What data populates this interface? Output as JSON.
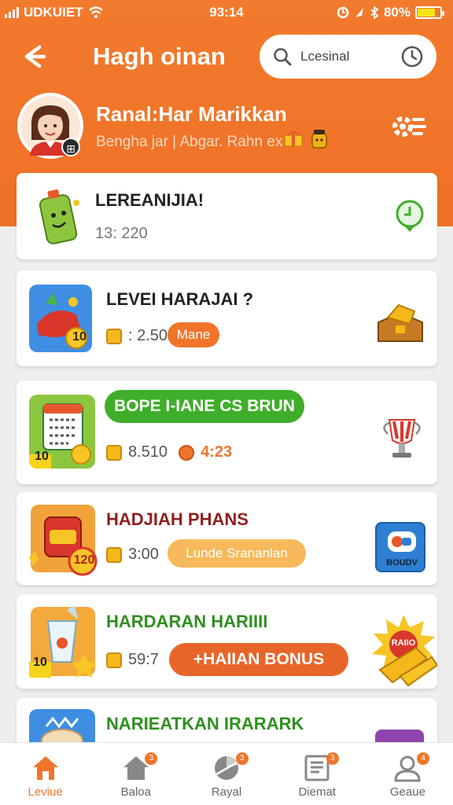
{
  "status_bar": {
    "carrier": "UDKUIET",
    "time": "93:14",
    "battery_text": "80%",
    "battery_level": 0.8
  },
  "header": {
    "title": "Hagh oinan",
    "search_placeholder": "Lcesinal"
  },
  "profile": {
    "name": "Ranal:Har Marikkan",
    "subtitle": "Bengha jar | Abgar. Rahn ex"
  },
  "cards": [
    {
      "title": "LEREANIJIA!",
      "meta": "13: 220"
    },
    {
      "title": "LEVEI HARAJAI  ?",
      "meta": ": 2.50",
      "pill": "Mane",
      "thumb_badge": "10"
    },
    {
      "title_pill": "BOPE I-IANE CS BRUN",
      "meta": "8.510",
      "meta2": "4:23",
      "thumb_badge": "10"
    },
    {
      "title": "HADJIAH PHANS",
      "meta": "3:00",
      "pill": "Lunde Srananlan",
      "thumb_badge": "120",
      "right_label": "BOUDV"
    },
    {
      "title": "HARDARAN HARIIII",
      "meta": "59:7",
      "pill": "+HAIIAN BONUS",
      "thumb_badge": "10",
      "right_label": "RAIIO"
    },
    {
      "title": "NARIEATKAN IRARARK"
    }
  ],
  "nav": [
    {
      "label": "Leviue",
      "icon": "home-icon",
      "active": true
    },
    {
      "label": "Baloa",
      "icon": "house-icon",
      "badge": "3"
    },
    {
      "label": "Rayal",
      "icon": "chart-icon",
      "badge": "3"
    },
    {
      "label": "Diemat",
      "icon": "document-icon",
      "badge": "3"
    },
    {
      "label": "Geaue",
      "icon": "user-icon",
      "badge": "4"
    }
  ],
  "colors": {
    "brand_orange": "#f0752a",
    "green": "#3fae2a",
    "maroon": "#8f1f1f",
    "dark_green": "#2f8f1f",
    "light_orange_pill": "#f7b95b"
  }
}
